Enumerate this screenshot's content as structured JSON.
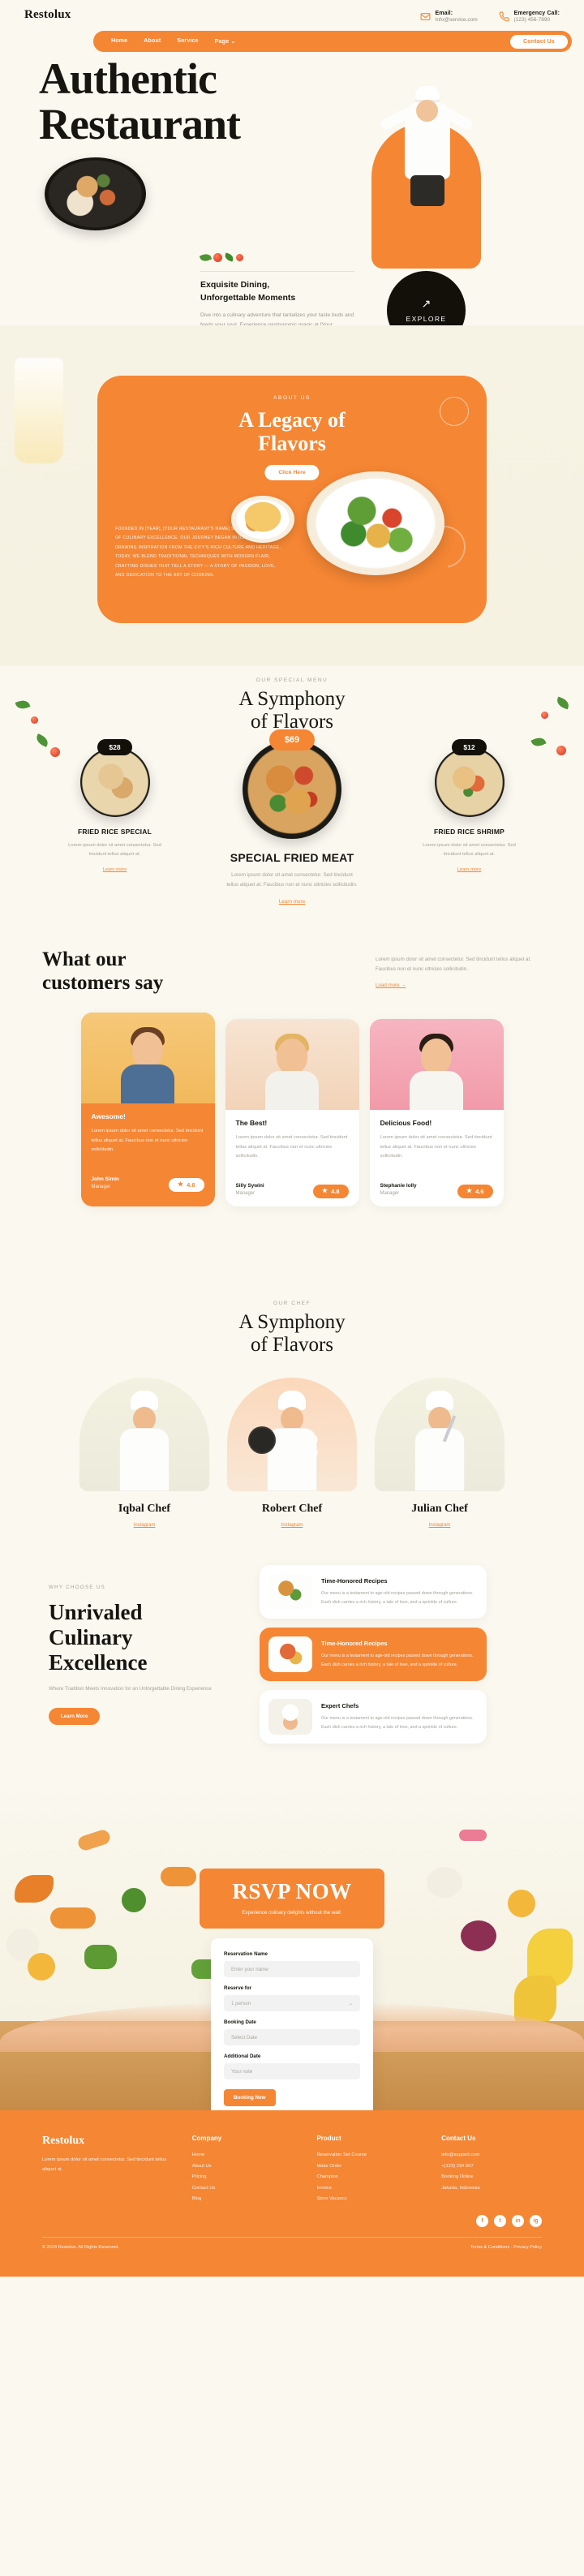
{
  "brand": "Restolux",
  "header": {
    "nav": [
      {
        "label": "Home",
        "active": true
      },
      {
        "label": "About",
        "active": false
      },
      {
        "label": "Service",
        "active": false
      },
      {
        "label": "Page",
        "active": false,
        "caret": "⌄"
      }
    ],
    "contact_button": "Contact Us",
    "email_label": "Email:",
    "email_value": "Info@service.com",
    "phone_label": "Emergency Call:",
    "phone_value": "(123) 456-7890"
  },
  "hero": {
    "title_line1": "Authentic",
    "title_line2": "Restaurant",
    "subtitle_line1": "Exquisite Dining,",
    "subtitle_line2": "Unforgettable Moments",
    "paragraph": "Dive into a culinary adventure that tantalizes your taste buds and feeds your soul. Experience gastronomic magic at [Your Restaurant's Name].",
    "explore_label": "EXPLORE",
    "explore_arrow": "↗"
  },
  "about": {
    "eyebrow": "ABOUT US",
    "title_line1": "A Legacy of",
    "title_line2": "Flavors",
    "button": "Click Here",
    "body": "FOUNDED IN [YEAR], [YOUR RESTAURANT'S NAME] STANDS AS A BEACON OF CULINARY EXCELLENCE. OUR JOURNEY BEGAN IN [CITY/PLACE], DRAWING INSPIRATION FROM THE CITY'S RICH CULTURE AND HERITAGE. TODAY, WE BLEND TRADITIONAL TECHNIQUES WITH MODERN FLAIR, CRAFTING DISHES THAT TELL A STORY — A STORY OF PASSION, LOVE, AND DEDICATION TO THE ART OF COOKING."
  },
  "menu": {
    "eyebrow": "OUR SPECIAL MENU",
    "title_line1": "A Symphony",
    "title_line2": "of Flavors",
    "items": [
      {
        "price": "$28",
        "name": "FRIED RICE SPECIAL",
        "desc": "Lorem ipsum dolor sit amet consectetur. Sed tincidunt tellus aliquet at.",
        "link": "Learn more"
      },
      {
        "price": "$69",
        "name": "SPECIAL FRIED MEAT",
        "desc": "Lorem ipsum dolor sit amet consectetur. Sed tincidunt tellus aliquet at. Faucibus non et nunc ultricies sollicitudin.",
        "link": "Learn more"
      },
      {
        "price": "$12",
        "name": "FRIED RICE SHRIMP",
        "desc": "Lorem ipsum dolor sit amet consectetur. Sed tincidunt tellus aliquet at.",
        "link": "Learn more"
      }
    ]
  },
  "testimonials": {
    "title_line1": "What our",
    "title_line2": "customers say",
    "intro": "Lorem ipsum dolor sit amet consectetur. Sed tincidunt tellus aliquet at. Faucibus non et nunc ultricies sollicitudin.",
    "load_more": "Load more →",
    "cards": [
      {
        "heading": "Awesome!",
        "quote": "Lorem ipsum dolor sit amet consectetur. Sed tincidunt tellus aliquet at. Faucibus non et nunc ultricies sollicitudin.",
        "name": "John Simin",
        "role": "Manager",
        "rating": "4.6"
      },
      {
        "heading": "The Best!",
        "quote": "Lorem ipsum dolor sit amet consectetur. Sed tincidunt tellus aliquet at. Faucibus non et nunc ultricies sollicitudin.",
        "name": "Silly Sywini",
        "role": "Manager",
        "rating": "4.8"
      },
      {
        "heading": "Delicious Food!",
        "quote": "Lorem ipsum dolor sit amet consectetur. Sed tincidunt tellus aliquet at. Faucibus non et nunc ultricies sollicitudin.",
        "name": "Stephanie lolly",
        "role": "Manager",
        "rating": "4.6"
      }
    ]
  },
  "chefs": {
    "eyebrow": "OUR CHEF",
    "title_line1": "A Symphony",
    "title_line2": "of Flavors",
    "list": [
      {
        "name": "Iqbal Chef",
        "link": "Instagram"
      },
      {
        "name": "Robert Chef",
        "link": "Instagram"
      },
      {
        "name": "Julian Chef",
        "link": "Instagram"
      }
    ]
  },
  "why": {
    "eyebrow": "WHY CHOOSE US",
    "title_line1": "Unrivaled",
    "title_line2": "Culinary",
    "title_line3": "Excellence",
    "subtitle": "Where Tradition Meets Innovation for an Unforgettable Dining Experience",
    "button": "Learn More",
    "features": [
      {
        "title": "Time-Honored Recipes",
        "desc": "Our menu is a testament to age-old recipes passed down through generations. Each dish carries a rich history, a tale of love, and a sprinkle of culture.",
        "highlight": false
      },
      {
        "title": "Time-Honored Recipes",
        "desc": "Our menu is a testament to age-old recipes passed down through generations. Each dish carries a rich history, a tale of love, and a sprinkle of culture.",
        "highlight": true
      },
      {
        "title": "Expert Chefs",
        "desc": "Our menu is a testament to age-old recipes passed down through generations. Each dish carries a rich history, a tale of love, and a sprinkle of culture.",
        "highlight": false
      }
    ]
  },
  "rsvp": {
    "title": "RSVP NOW",
    "subtitle": "Experience culinary delights without the wait.",
    "fields": [
      {
        "label": "Reservation Name",
        "placeholder": "Enter your name",
        "type": "input"
      },
      {
        "label": "Reserve for",
        "placeholder": "1 person",
        "type": "select"
      },
      {
        "label": "Booking Date",
        "placeholder": "Select Date",
        "type": "input"
      },
      {
        "label": "Additional Date",
        "placeholder": "Your note",
        "type": "input"
      }
    ],
    "submit": "Booking Now"
  },
  "footer": {
    "brand": "Restolux",
    "tagline": "Lorem ipsum dolor sit amet consectetur. Sed tincidunt tellus aliquet at.",
    "columns": [
      {
        "title": "Company",
        "links": [
          "Home",
          "About Us",
          "Pricing",
          "Contact Us",
          "Blog"
        ]
      },
      {
        "title": "Product",
        "links": [
          "Reservation Set Course",
          "Make Order",
          "Champion",
          "Invoice",
          "Store Vacancy"
        ]
      },
      {
        "title": "Contact Us",
        "links": [
          "info@support.com",
          "+(123) 234 567",
          "Booking Online",
          "Jakarta, Indonesia"
        ]
      }
    ],
    "socials": [
      "f",
      "t",
      "in",
      "ig"
    ],
    "copyright": "© 2024 Restolux. All Rights Reserved.",
    "legal": "Terms & Conditions · Privacy Policy"
  },
  "colors": {
    "accent": "#f58634",
    "dark": "#16150f",
    "cream": "#faf8ef"
  }
}
